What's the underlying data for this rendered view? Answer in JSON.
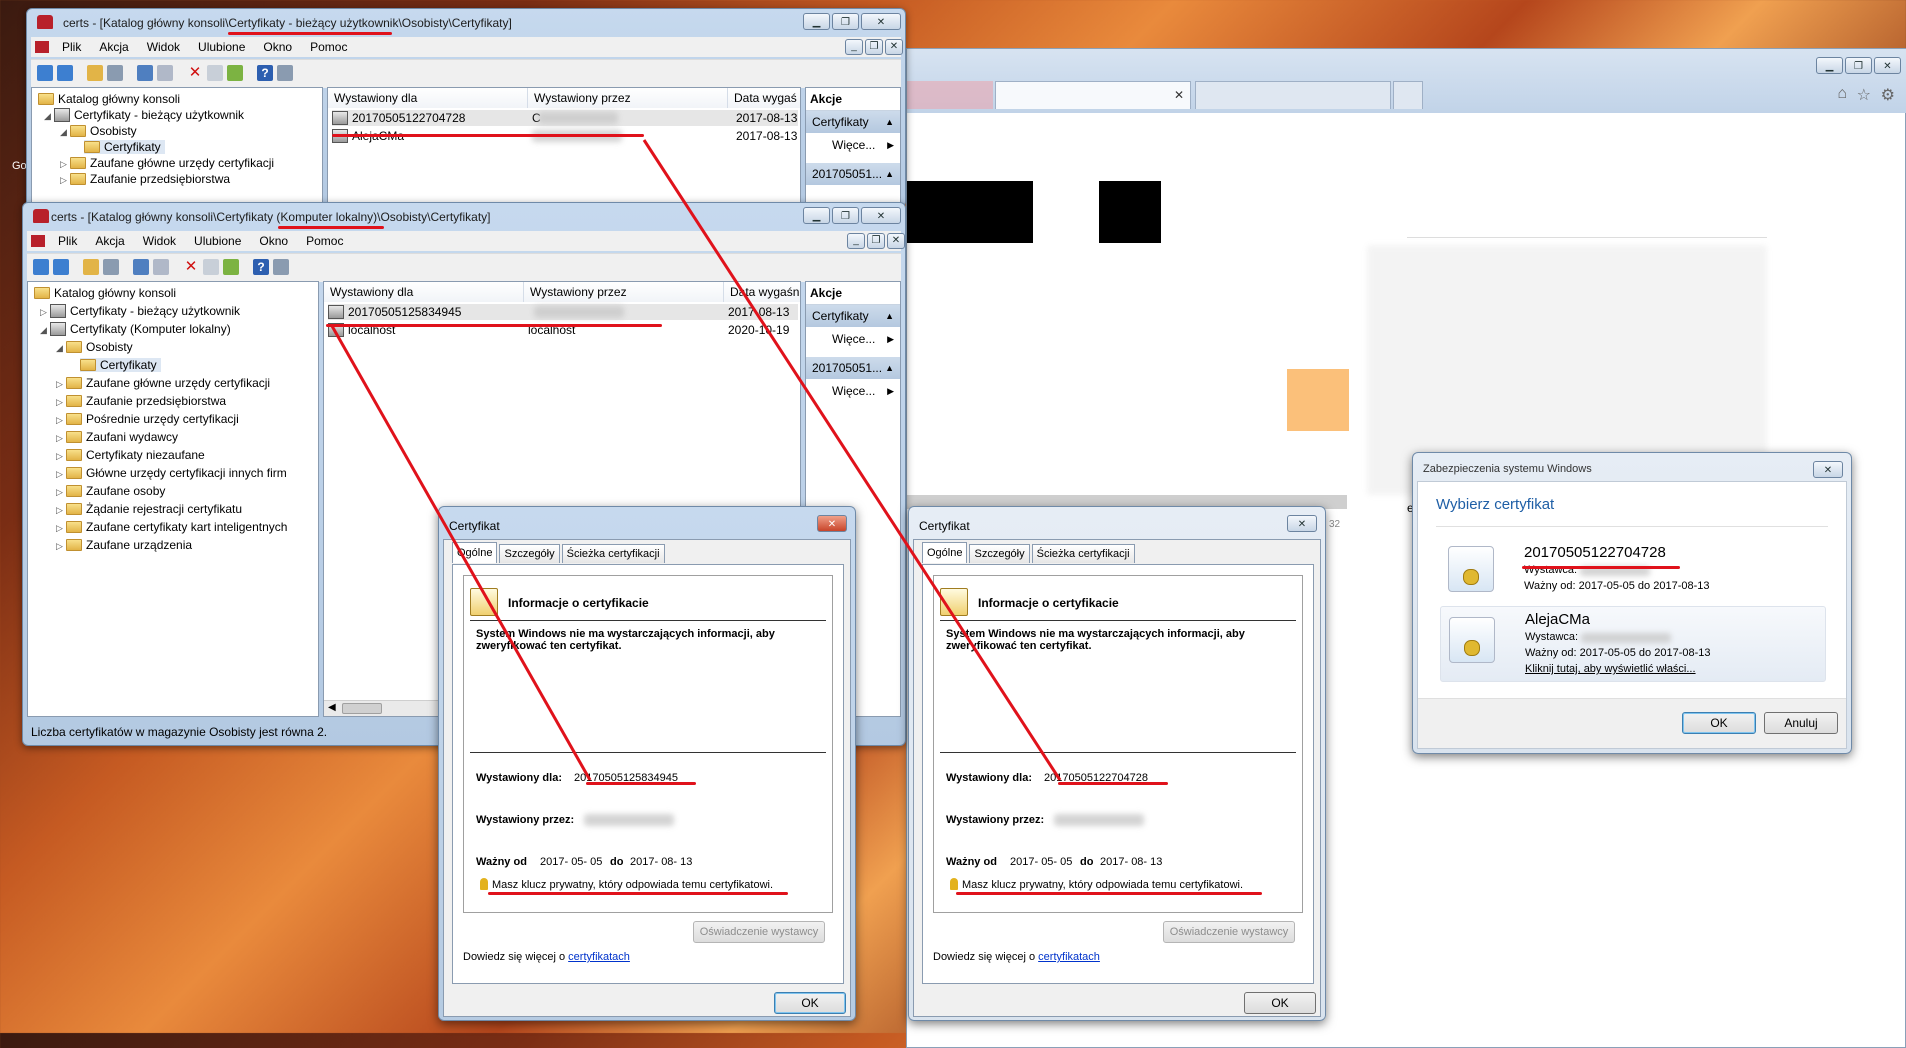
{
  "mmc_user": {
    "title": "certs - [Katalog główny konsoli\\Certyfikaty - bieżący użytkownik\\Osobisty\\Certyfikaty]",
    "menu": [
      "Plik",
      "Akcja",
      "Widok",
      "Ulubione",
      "Okno",
      "Pomoc"
    ],
    "tree": [
      "Katalog główny konsoli",
      "Certyfikaty - bieżący użytkownik",
      "Osobisty",
      "Certyfikaty",
      "Zaufane główne urzędy certyfikacji",
      "Zaufanie przedsiębiorstwa"
    ],
    "columns": [
      "Wystawiony dla",
      "Wystawiony przez",
      "Data wygaś"
    ],
    "rows": [
      {
        "issued_to": "20170505122704728",
        "issued_by": "C",
        "expires": "2017-08-13"
      },
      {
        "issued_to": "AlejaCMa",
        "issued_by": "",
        "expires": "2017-08-13"
      }
    ],
    "actions": {
      "header": "Akcje",
      "section1": "Certyfikaty",
      "more1": "Więce...",
      "section2": "201705051..."
    }
  },
  "mmc_machine": {
    "title": "certs - [Katalog główny konsoli\\Certyfikaty (Komputer lokalny)\\Osobisty\\Certyfikaty]",
    "menu": [
      "Plik",
      "Akcja",
      "Widok",
      "Ulubione",
      "Okno",
      "Pomoc"
    ],
    "tree": [
      "Katalog główny konsoli",
      "Certyfikaty - bieżący użytkownik",
      "Certyfikaty (Komputer lokalny)",
      "Osobisty",
      "Certyfikaty",
      "Zaufane główne urzędy certyfikacji",
      "Zaufanie przedsiębiorstwa",
      "Pośrednie urzędy certyfikacji",
      "Zaufani wydawcy",
      "Certyfikaty niezaufane",
      "Główne urzędy certyfikacji innych firm",
      "Zaufane osoby",
      "Żądanie rejestracji certyfikatu",
      "Zaufane certyfikaty kart inteligentnych",
      "Zaufane urządzenia"
    ],
    "columns": [
      "Wystawiony dla",
      "Wystawiony przez",
      "Data wygaśn"
    ],
    "rows": [
      {
        "issued_to": "20170505125834945",
        "issued_by": "",
        "expires": "2017-08-13"
      },
      {
        "issued_to": "localhost",
        "issued_by": "localhost",
        "expires": "2020-10-19"
      }
    ],
    "actions": {
      "header": "Akcje",
      "section1": "Certyfikaty",
      "more1": "Więce...",
      "section2": "201705051...",
      "more2": "Więce..."
    },
    "status": "Liczba certyfikatów w magazynie Osobisty jest równa 2."
  },
  "cert_dialog_1": {
    "title": "Certyfikat",
    "tabs": [
      "Ogólne",
      "Szczegóły",
      "Ścieżka certyfikacji"
    ],
    "info_heading": "Informacje o certyfikacie",
    "warning": "System Windows nie ma wystarczających informacji, aby zweryfikować ten certyfikat.",
    "issued_to_label": "Wystawiony dla:",
    "issued_to": "20170505125834945",
    "issued_by_label": "Wystawiony przez:",
    "valid_label": "Ważny od",
    "valid_from": "2017- 05- 05",
    "valid_to_word": "do",
    "valid_to": "2017- 08- 13",
    "key_note": "Masz klucz prywatny, który odpowiada temu certyfikatowi.",
    "statement_btn": "Oświadczenie wystawcy",
    "learn_more": "Dowiedz się więcej o",
    "learn_link": "certyfikatach",
    "ok": "OK"
  },
  "cert_dialog_2": {
    "title": "Certyfikat",
    "tabs": [
      "Ogólne",
      "Szczegóły",
      "Ścieżka certyfikacji"
    ],
    "info_heading": "Informacje o certyfikacie",
    "warning": "System Windows nie ma wystarczających informacji, aby zweryfikować ten certyfikat.",
    "issued_to_label": "Wystawiony dla:",
    "issued_to": "20170505122704728",
    "issued_by_label": "Wystawiony przez:",
    "valid_label": "Ważny od",
    "valid_from": "2017- 05- 05",
    "valid_to_word": "do",
    "valid_to": "2017- 08- 13",
    "key_note": "Masz klucz prywatny, który odpowiada temu certyfikatowi.",
    "statement_btn": "Oświadczenie wystawcy",
    "learn_more": "Dowiedz się więcej o",
    "learn_link": "certyfikatach",
    "ok": "OK"
  },
  "security_dialog": {
    "title": "Zabezpieczenia systemu Windows",
    "heading": "Wybierz certyfikat",
    "certs": [
      {
        "name": "20170505122704728",
        "issuer_label": "Wystawca:",
        "validity": "Ważny od: 2017-05-05 do 2017-08-13"
      },
      {
        "name": "AlejaCMa",
        "issuer_label": "Wystawca:",
        "validity": "Ważny od: 2017-05-05 do 2017-08-13",
        "link": "Kliknij tutaj, aby wyświetlić właści..."
      }
    ],
    "ok": "OK",
    "cancel": "Anuluj"
  },
  "browser": {
    "go_fragment": "Go",
    "e_fragment": "e",
    "num_fragment": "32"
  },
  "colors": {
    "annotation_red": "#e0121b",
    "accent_blue": "#1f5fa6"
  }
}
